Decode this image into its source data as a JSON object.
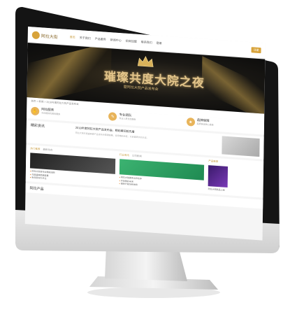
{
  "site": {
    "logo_text": "阿拉大街",
    "nav": [
      "首页",
      "关于我们",
      "产品服务",
      "新闻中心",
      "招商加盟",
      "联系我们"
    ],
    "nav_button": "注册",
    "nav_login": "登录"
  },
  "banner": {
    "title": "璀璨共度大院之夜",
    "subtitle": "暨阿拉大院产品发布会"
  },
  "breadcrumb": "首页 > 新闻 > 2018年度阿拉大院产品发布会",
  "features": [
    {
      "icon": "hand-icon",
      "title": "阿拉服务",
      "desc": "为您提供优质的服务"
    },
    {
      "icon": "chat-icon",
      "title": "专业团队",
      "desc": "专业人员为您服务"
    },
    {
      "icon": "trophy-icon",
      "title": "品牌保障",
      "desc": "品质保证放心选择"
    }
  ],
  "news": {
    "heading": "精彩资讯",
    "title": "2018年度阿拉大院产品发布会，精彩瞬间抢先看",
    "desc": "阿拉大院年度盛典暨产品发布会圆满落幕，现场精彩纷呈，众多嘉宾共同见证。"
  },
  "blocks": [
    {
      "tabs": [
        "热门推荐",
        "最新动态"
      ],
      "lines": [
        "阿拉大院发布会精彩回顾",
        "年度盛典圆满落幕",
        "新品发布引关注"
      ]
    },
    {
      "tabs": [
        "行业资讯",
        "公司新闻"
      ],
      "lines": [
        "阿拉大院携手合作伙伴",
        "共创美好未来",
        "服务升级全新体验"
      ]
    },
    {
      "tabs": [
        "产品推荐"
      ],
      "lines": [
        "阿拉大院新品上线"
      ]
    }
  ],
  "bottom_heading": "阿拉产品",
  "colors": {
    "accent": "#d8a33a",
    "banner_bg": "#121212"
  }
}
